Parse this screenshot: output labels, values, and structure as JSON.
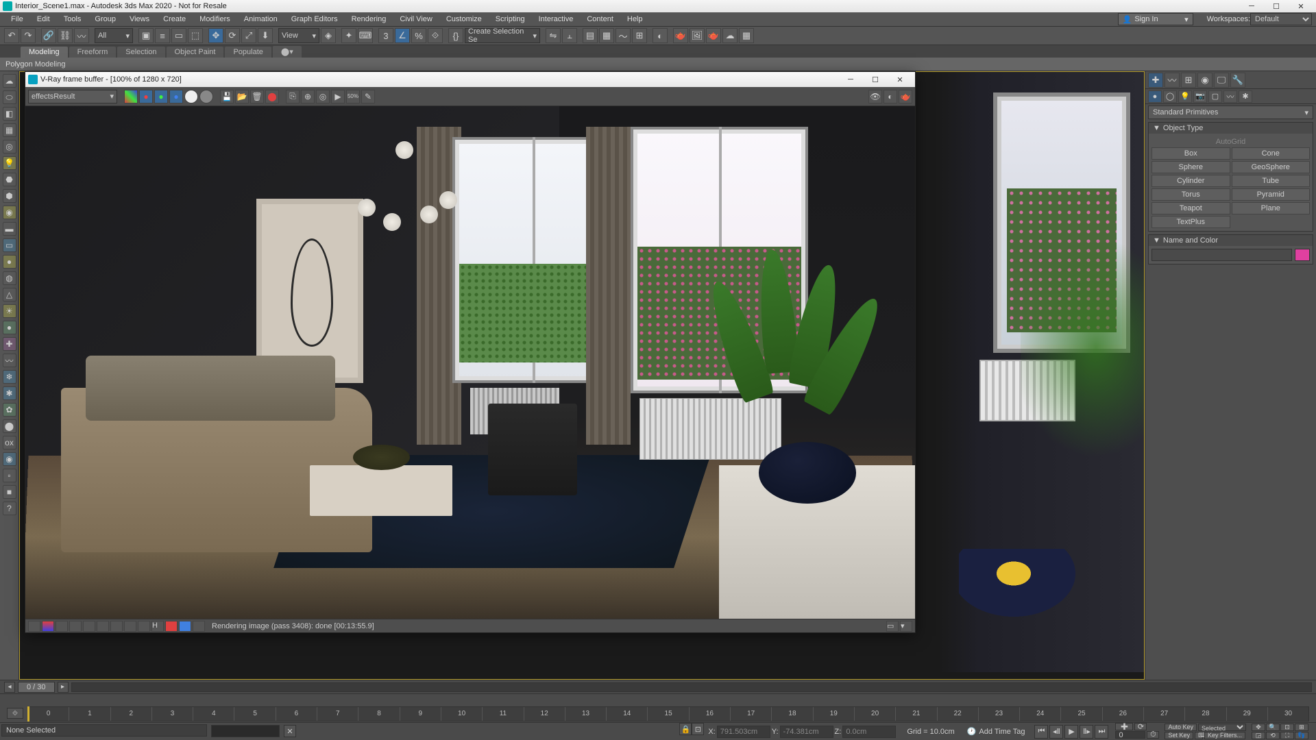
{
  "app": {
    "title": "Interior_Scene1.max - Autodesk 3ds Max 2020 - Not for Resale",
    "signin": "Sign In",
    "workspaces_label": "Workspaces:",
    "workspace_selected": "Default"
  },
  "menu": [
    "File",
    "Edit",
    "Tools",
    "Group",
    "Views",
    "Create",
    "Modifiers",
    "Animation",
    "Graph Editors",
    "Rendering",
    "Civil View",
    "Customize",
    "Scripting",
    "Interactive",
    "Content",
    "Help"
  ],
  "toolbar": {
    "filter_sel": "All",
    "view_sel": "View",
    "named_sel": "Create Selection Se"
  },
  "ribbon": {
    "tabs": [
      "Modeling",
      "Freeform",
      "Selection",
      "Object Paint",
      "Populate"
    ],
    "panel": "Polygon Modeling"
  },
  "vfb": {
    "title": "V-Ray frame buffer - [100% of 1280 x 720]",
    "channel_sel": "effectsResult",
    "status": "Rendering image (pass 3408): done [00:13:55.9]"
  },
  "command_panel": {
    "category": "Standard Primitives",
    "rollout_objtype": "Object Type",
    "autogrid": "AutoGrid",
    "primitives": [
      "Box",
      "Cone",
      "Sphere",
      "GeoSphere",
      "Cylinder",
      "Tube",
      "Torus",
      "Pyramid",
      "Teapot",
      "Plane",
      "TextPlus",
      ""
    ],
    "rollout_namecolor": "Name and Color",
    "name_value": ""
  },
  "timeslider": {
    "label": "0 / 30"
  },
  "trackbar": {
    "ticks": [
      "0",
      "1",
      "2",
      "3",
      "4",
      "5",
      "6",
      "7",
      "8",
      "9",
      "10",
      "11",
      "12",
      "13",
      "14",
      "15",
      "16",
      "17",
      "18",
      "19",
      "20",
      "21",
      "22",
      "23",
      "24",
      "25",
      "26",
      "27",
      "28",
      "29",
      "30"
    ]
  },
  "status": {
    "prompt": "None Selected",
    "x": "791.503cm",
    "y": "-74.381cm",
    "z": "0.0cm",
    "grid": "Grid = 10.0cm",
    "timetag": "Add Time Tag",
    "frame": "0",
    "autokey": "Auto Key",
    "setkey": "Set Key",
    "keymode": "Selected",
    "keyfilters": "Key Filters..."
  }
}
